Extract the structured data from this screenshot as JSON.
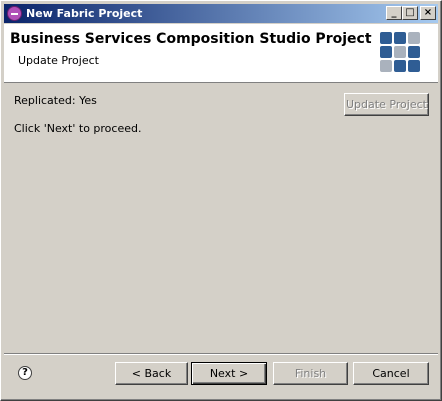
{
  "window": {
    "title": "New Fabric Project"
  },
  "titlebar_buttons": {
    "minimize": "_",
    "maximize": "□",
    "close": "×"
  },
  "banner": {
    "title": "Business Services Composition Studio Project",
    "subtitle": "Update Project"
  },
  "content": {
    "replicated_label": "Replicated:",
    "replicated_value": "Yes",
    "instruction": "Click 'Next' to proceed.",
    "update_button": "Update Project"
  },
  "footer": {
    "help_label": "?",
    "back_label": "< Back",
    "next_label": "Next >",
    "finish_label": "Finish",
    "cancel_label": "Cancel"
  },
  "colors": {
    "title_gradient_start": "#0a246a",
    "title_gradient_end": "#a6caf0",
    "logo_dark": "#2f5d94",
    "logo_light": "#aab2bd",
    "dialog_bg": "#d4d0c8"
  }
}
